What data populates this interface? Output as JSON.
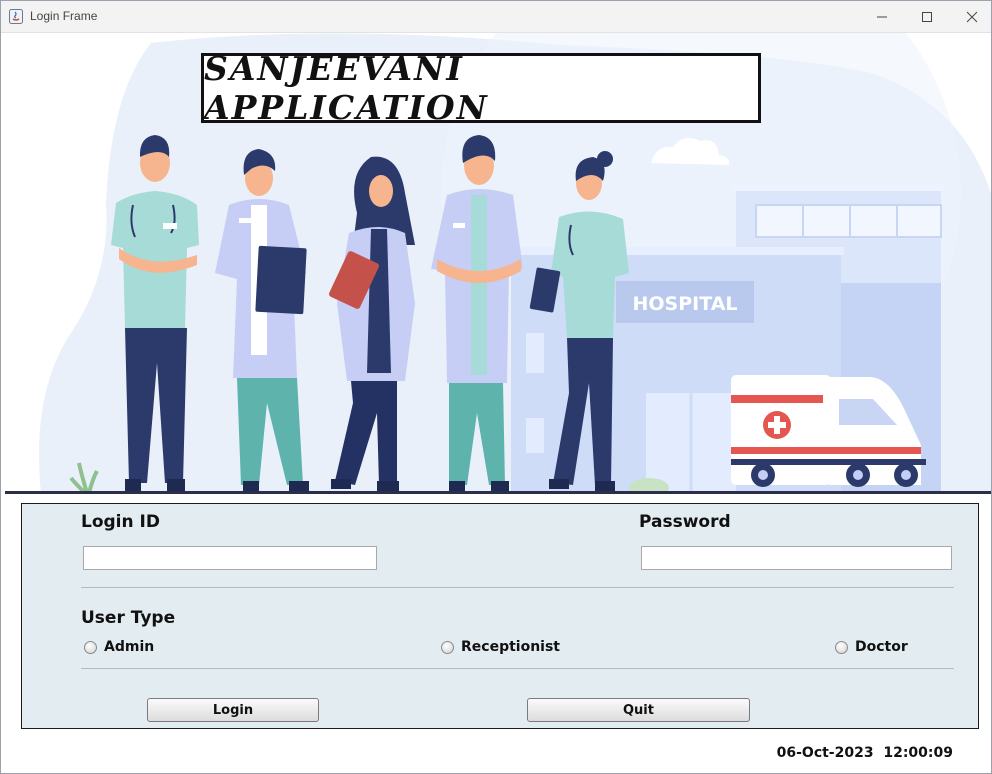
{
  "window": {
    "title": "Login Frame",
    "controls": [
      "minimize-icon",
      "maximize-icon",
      "close-icon"
    ]
  },
  "banner": {
    "heading": "SANJEEVANI APPLICATION",
    "hospital_sign": "HOSPITAL"
  },
  "form": {
    "login_id_label": "Login ID",
    "login_id_value": "",
    "password_label": "Password",
    "password_value": "",
    "user_type_label": "User Type",
    "user_types": [
      "Admin",
      "Receptionist",
      "Doctor"
    ],
    "login_button": "Login",
    "quit_button": "Quit"
  },
  "status": {
    "date": "06-Oct-2023",
    "time": "12:00:09"
  },
  "colors": {
    "panel_bg": "#e3edf1",
    "scrub_teal": "#a7dbd8",
    "navy": "#2b3a6b",
    "coat": "#c6cef5",
    "ambulance_red": "#e4564f"
  }
}
